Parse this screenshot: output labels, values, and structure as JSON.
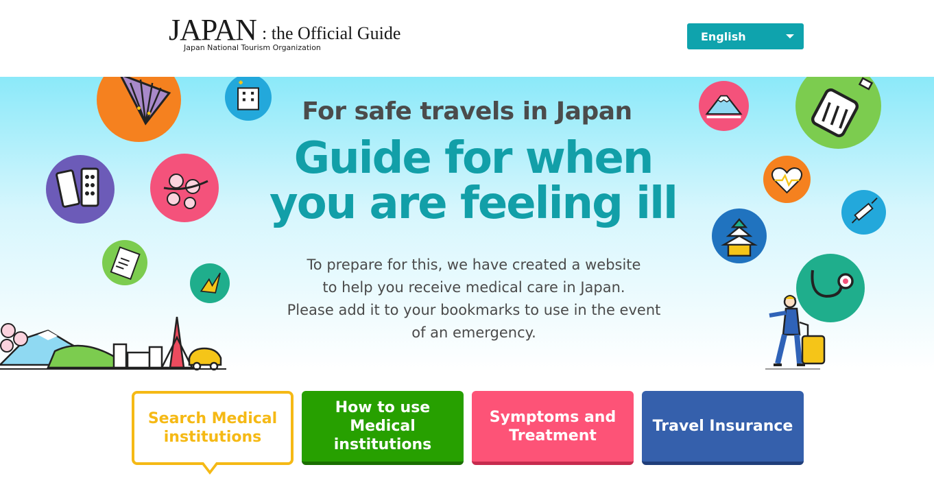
{
  "header": {
    "logo": {
      "main": "JAPAN",
      "sub": ": the Official Guide",
      "org": "Japan National Tourism Organization"
    },
    "language": {
      "selected": "English",
      "icon": "chevron-down-icon"
    }
  },
  "hero": {
    "subtitle": "For safe travels in Japan",
    "title_line1": "Guide for when",
    "title_line2": "you are feeling ill",
    "desc_line1": "To prepare for this, we have created a website",
    "desc_line2": "to help you receive medical care in Japan.",
    "desc_line3": "Please add it to your bookmarks to use in the event",
    "desc_line4": "of an emergency.",
    "icons": [
      "folding-fan-icon",
      "hospital-icon",
      "medicine-pills-icon",
      "cherry-blossom-icon",
      "clipboard-icon",
      "paper-crane-icon",
      "mount-fuji-icon",
      "suitcase-icon",
      "heart-pulse-icon",
      "syringe-icon",
      "castle-icon",
      "stethoscope-icon",
      "traveler-illustration",
      "cityscape-illustration"
    ]
  },
  "nav": {
    "search": "Search Medical institutions",
    "how_to_use": "How to use Medical institutions",
    "symptoms": "Symptoms and Treatment",
    "insurance": "Travel Insurance"
  },
  "colors": {
    "accent": "#129fa8",
    "search": "#f5b915",
    "how_to_use": "#27a000",
    "symptoms": "#fd5377",
    "insurance": "#3560ac"
  }
}
